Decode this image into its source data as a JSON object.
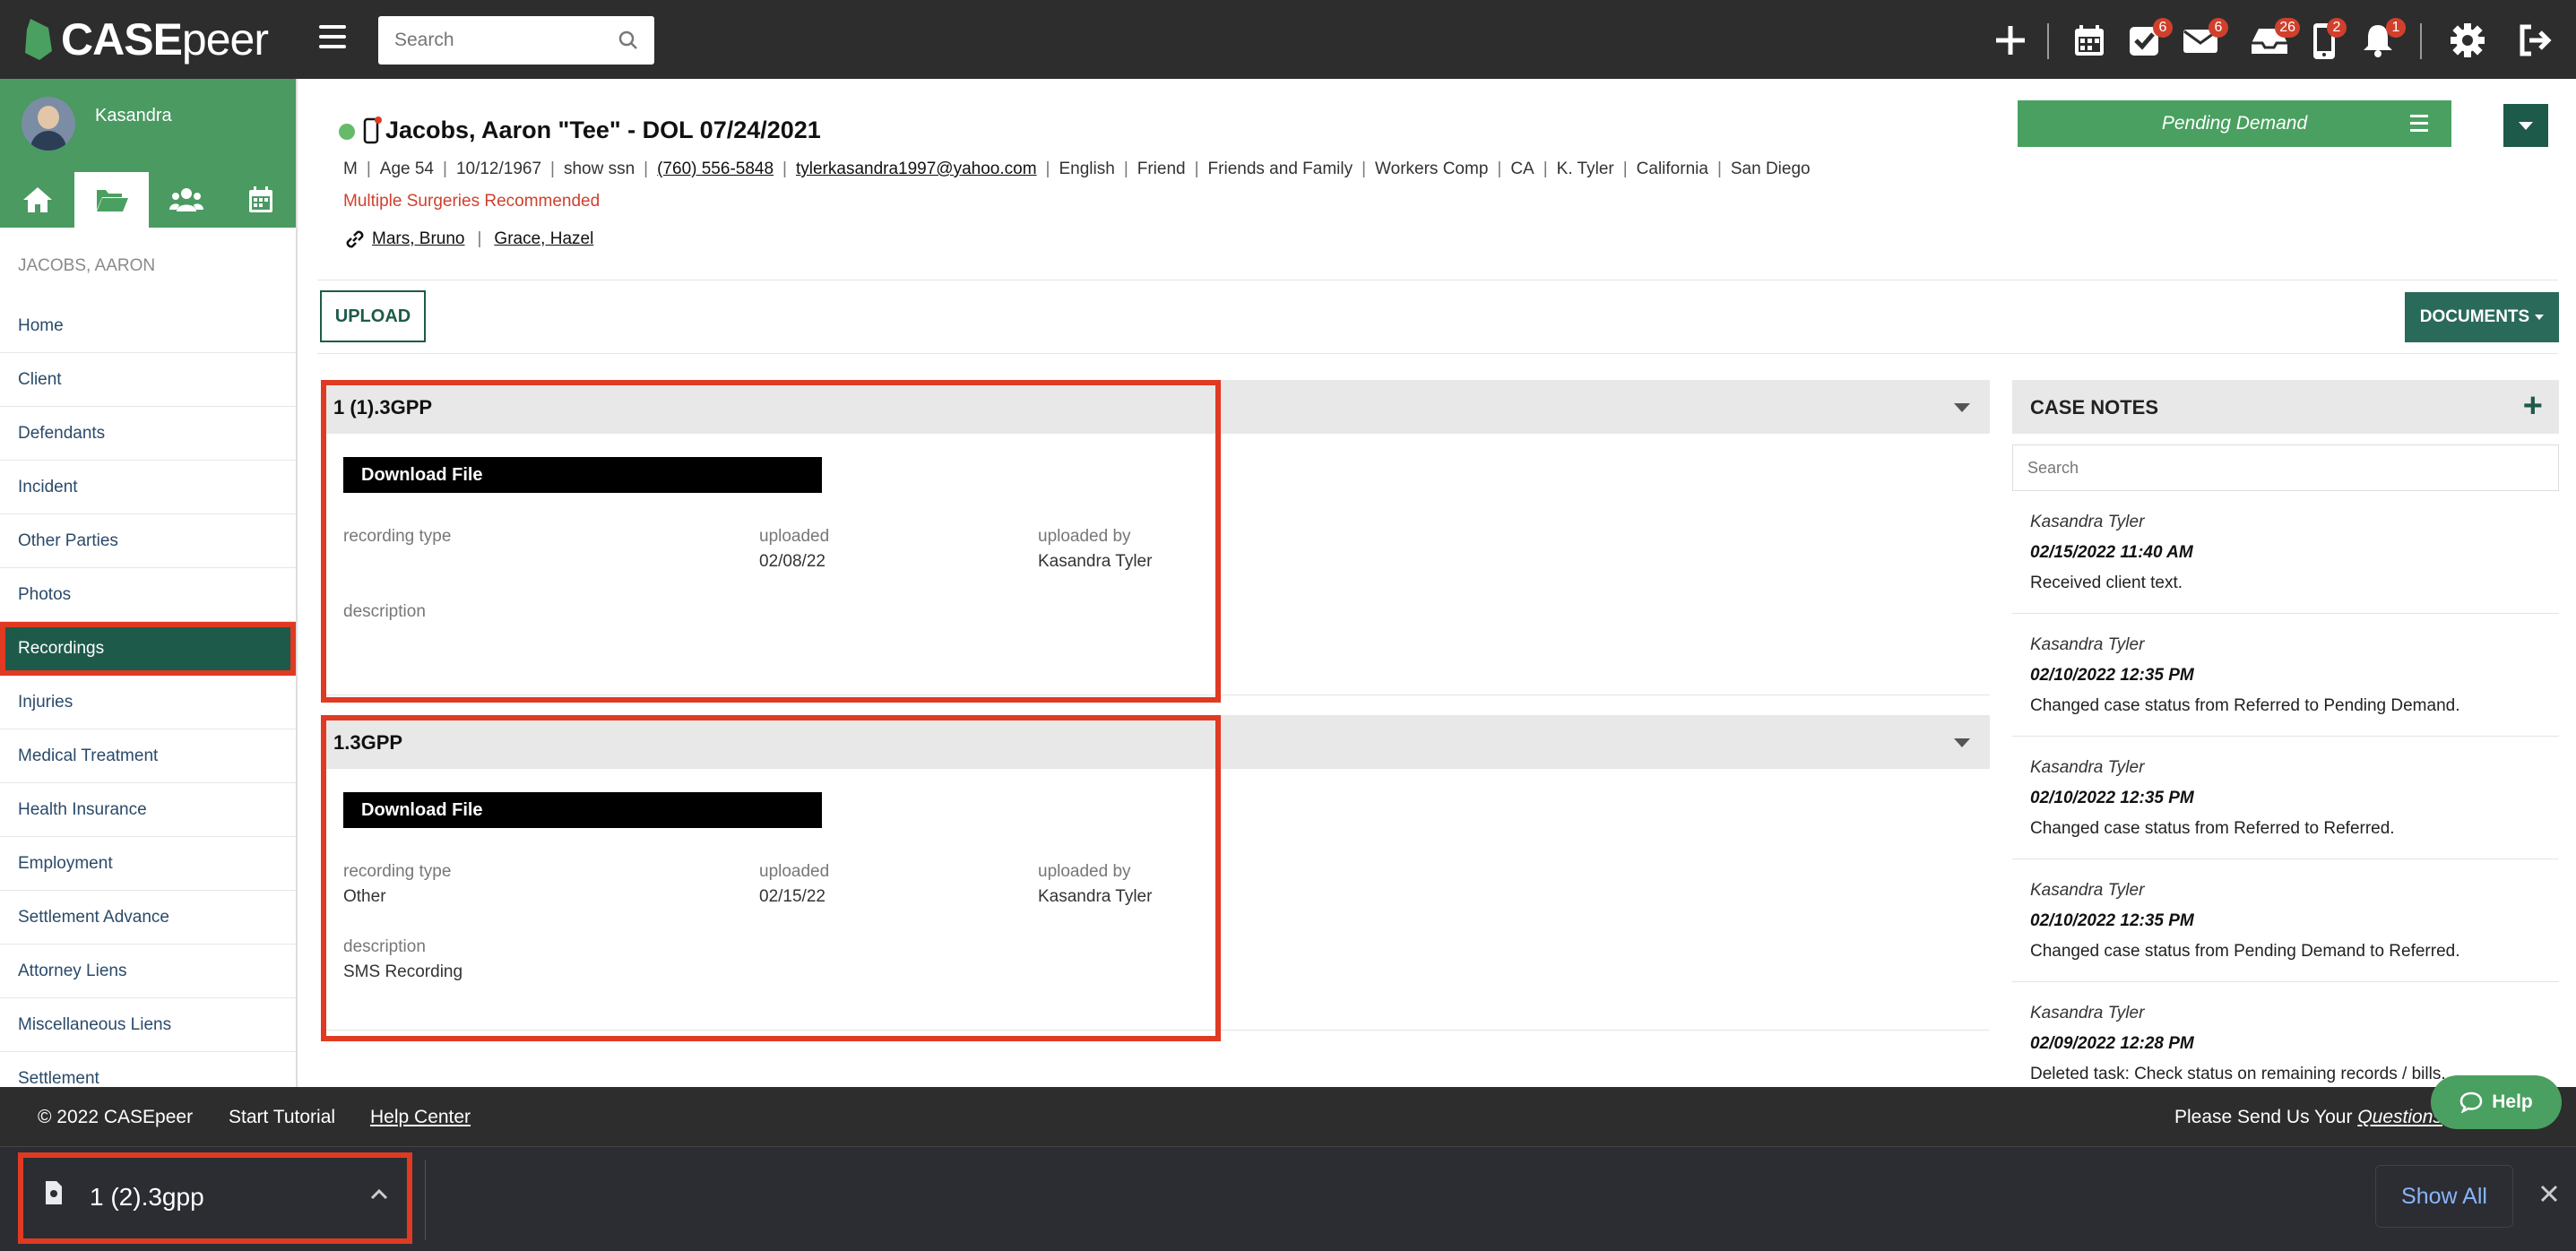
{
  "app": {
    "logo_text_bold": "CASE",
    "logo_text_rest": "peer"
  },
  "topbar": {
    "search_placeholder": "Search",
    "badges": {
      "tasks": "6",
      "mail": "6",
      "inbox": "26",
      "phone": "2",
      "bell": "1"
    }
  },
  "sidebar": {
    "user": "Kasandra",
    "case_name": "JACOBS, AARON",
    "items": [
      "Home",
      "Client",
      "Defendants",
      "Incident",
      "Other Parties",
      "Photos",
      "Recordings",
      "Injuries",
      "Medical Treatment",
      "Health Insurance",
      "Employment",
      "Settlement Advance",
      "Attorney Liens",
      "Miscellaneous Liens",
      "Settlement"
    ],
    "active": "Recordings"
  },
  "case": {
    "title": "Jacobs, Aaron \"Tee\" - DOL 07/24/2021",
    "meta": {
      "gender": "M",
      "age": "Age 54",
      "dob": "10/12/1967",
      "ssn": "show ssn",
      "phone": "(760) 556-5848",
      "email": "tylerkasandra1997@yahoo.com",
      "language": "English",
      "referral": "Friend",
      "source": "Friends and Family",
      "case_type": "Workers Comp",
      "state": "CA",
      "attorney": "K. Tyler",
      "location_state": "California",
      "city": "San Diego"
    },
    "warning": "Multiple Surgeries Recommended",
    "linked": [
      "Mars, Bruno",
      "Grace, Hazel"
    ],
    "status": "Pending Demand"
  },
  "toolbar": {
    "upload": "UPLOAD",
    "documents": "DOCUMENTS"
  },
  "recordings": [
    {
      "name": "1 (1).3GPP",
      "download": "Download File",
      "type_label": "recording type",
      "type": "",
      "uploaded_label": "uploaded",
      "uploaded": "02/08/22",
      "by_label": "uploaded by",
      "by": "Kasandra Tyler",
      "desc_label": "description",
      "desc": ""
    },
    {
      "name": "1.3GPP",
      "download": "Download File",
      "type_label": "recording type",
      "type": "Other",
      "uploaded_label": "uploaded",
      "uploaded": "02/15/22",
      "by_label": "uploaded by",
      "by": "Kasandra Tyler",
      "desc_label": "description",
      "desc": "SMS Recording"
    }
  ],
  "case_notes": {
    "title": "CASE NOTES",
    "search_placeholder": "Search",
    "notes": [
      {
        "user": "Kasandra Tyler",
        "date": "02/15/2022 11:40 AM",
        "text": "Received client text."
      },
      {
        "user": "Kasandra Tyler",
        "date": "02/10/2022 12:35 PM",
        "text": "Changed case status from Referred to Pending Demand."
      },
      {
        "user": "Kasandra Tyler",
        "date": "02/10/2022 12:35 PM",
        "text": "Changed case status from Referred to Referred."
      },
      {
        "user": "Kasandra Tyler",
        "date": "02/10/2022 12:35 PM",
        "text": "Changed case status from Pending Demand to Referred."
      },
      {
        "user": "Kasandra Tyler",
        "date": "02/09/2022 12:28 PM",
        "text": "Deleted task: Check status on remaining records / bills."
      }
    ]
  },
  "footer": {
    "copyright": "© 2022 CASEpeer",
    "tutorial": "Start Tutorial",
    "help_center": "Help Center",
    "send_prefix": "Please Send Us Your",
    "send_link": "Questions",
    "help_button": "Help"
  },
  "downloads": {
    "file": "1 (2).3gpp",
    "show_all": "Show All"
  },
  "colors": {
    "brand_green": "#4aa060",
    "dark_teal": "#1e5a4a",
    "highlight_red": "#e03a22",
    "topbar": "#2d2d2d"
  }
}
